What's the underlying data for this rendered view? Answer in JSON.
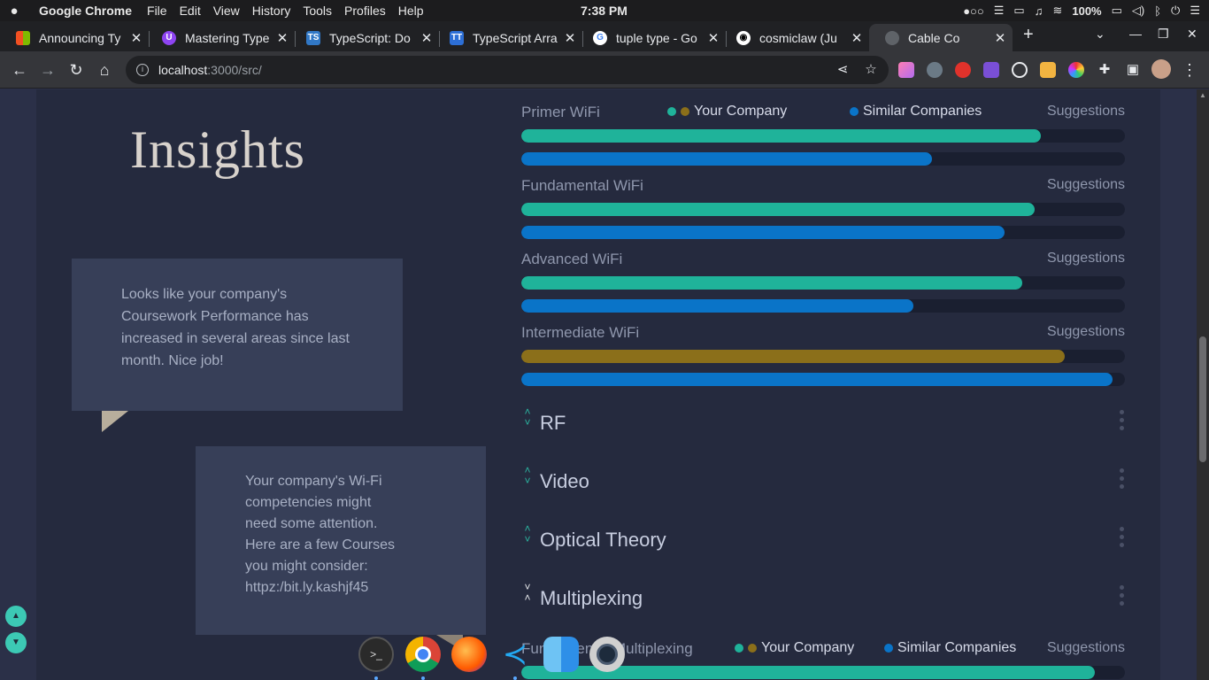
{
  "menubar": {
    "app_name": "Google Chrome",
    "items": [
      "File",
      "Edit",
      "View",
      "History",
      "Tools",
      "Profiles",
      "Help"
    ],
    "clock": "7:38 PM",
    "battery": "100%"
  },
  "tabs": [
    {
      "label": "Announcing Ty",
      "favicon": "microsoft-icon",
      "color": "#f25022",
      "active": false
    },
    {
      "label": "Mastering Type",
      "favicon": "purple-u-icon",
      "color": "#8e44f2",
      "active": false
    },
    {
      "label": "TypeScript: Do",
      "favicon": "ts-icon",
      "color": "#3178c6",
      "active": false
    },
    {
      "label": "TypeScript Arra",
      "favicon": "tt-icon",
      "color": "#2d6fd6",
      "active": false
    },
    {
      "label": "tuple type - Go",
      "favicon": "google-icon",
      "color": "#ffffff",
      "active": false
    },
    {
      "label": "cosmiclaw (Ju",
      "favicon": "github-icon",
      "color": "#ffffff",
      "active": false
    },
    {
      "label": "Cable Co",
      "favicon": "globe-icon",
      "color": "#9aa0a6",
      "active": true
    }
  ],
  "address": {
    "host": "localhost",
    "path": ":3000/src/"
  },
  "insights": {
    "title": "Insights",
    "bubble1": "Looks like your company's Coursework Performance has increased in several areas since last month. Nice job!",
    "bubble2_lines": [
      "Your company's Wi-Fi",
      "competencies might",
      "need some attention.",
      "Here are a few Courses",
      "you might consider:",
      "httpz:/bit.ly.kashjf45"
    ]
  },
  "legend": {
    "your_company": "Your Company",
    "similar_companies": "Similar Companies",
    "colors": {
      "teal": "#1fb39a",
      "gold": "#8b6f1a",
      "blue": "#0a74c8"
    }
  },
  "skills": [
    {
      "name": "Primer WiFi",
      "suggestions": "Suggestions",
      "your_company": 0.86,
      "similar": 0.68,
      "your_color": "#1fb39a",
      "show_legend": true
    },
    {
      "name": "Fundamental WiFi",
      "suggestions": "Suggestions",
      "your_company": 0.85,
      "similar": 0.8,
      "your_color": "#1fb39a",
      "show_legend": false
    },
    {
      "name": "Advanced WiFi",
      "suggestions": "Suggestions",
      "your_company": 0.83,
      "similar": 0.65,
      "your_color": "#1fb39a",
      "show_legend": false
    },
    {
      "name": "Intermediate WiFi",
      "suggestions": "Suggestions",
      "your_company": 0.9,
      "similar": 0.98,
      "your_color": "#8b6f1a",
      "show_legend": false
    }
  ],
  "sections": [
    {
      "name": "RF",
      "expanded": false
    },
    {
      "name": "Video",
      "expanded": false
    },
    {
      "name": "Optical Theory",
      "expanded": false
    },
    {
      "name": "Multiplexing",
      "expanded": true
    }
  ],
  "multiplexing_first": {
    "name": "Fundamental Multiplexing",
    "suggestions": "Suggestions",
    "your_company": 0.95
  },
  "dock": [
    "terminal-icon",
    "chrome-icon",
    "firefox-icon",
    "vscode-icon",
    "finder-icon",
    "camera-icon"
  ]
}
